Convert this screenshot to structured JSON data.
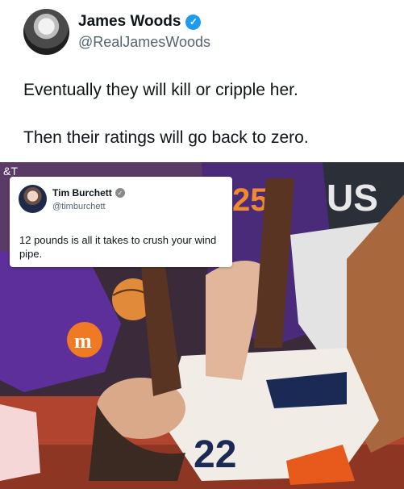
{
  "tweet": {
    "name": "James Woods",
    "handle": "@RealJamesWoods",
    "line1": "Eventually they will kill or cripple her.",
    "line2": "Then their ratings will go back to zero."
  },
  "quote": {
    "name": "Tim Burchett",
    "handle": "@timburchett",
    "text": "12 pounds is all it takes to crush your wind pipe."
  },
  "photo": {
    "jersey_back_number": "25",
    "jersey_front_number": "22",
    "banner_text": "US",
    "corner_text": "&T"
  },
  "colors": {
    "verified": "#1d9bf0",
    "court": "#b0442f",
    "jersey_purple": "#4a2b7a",
    "jersey_white": "#f1ede6"
  }
}
